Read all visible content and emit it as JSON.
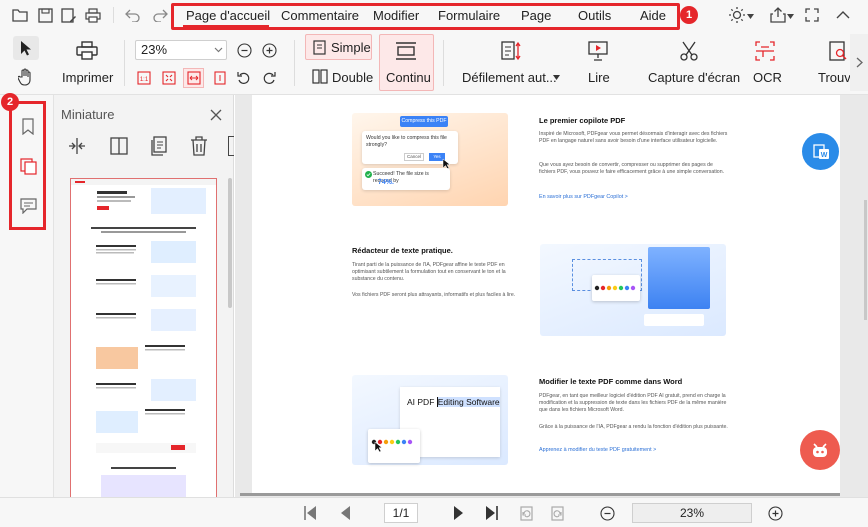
{
  "menu": {
    "tabs": [
      "Page d'accueil",
      "Commentaire",
      "Modifier",
      "Formulaire",
      "Page",
      "Outils",
      "Aide"
    ],
    "active_tab": "Page d'accueil",
    "annotation_1": "1",
    "annotation_2": "2"
  },
  "ribbon": {
    "print_label": "Imprimer",
    "zoom_value": "23%",
    "simple_label": "Simple",
    "double_label": "Double",
    "continu_label": "Continu",
    "scroll_label": "Défilement aut...",
    "read_label": "Lire",
    "capture_label": "Capture d'écran",
    "ocr_label": "OCR",
    "find_label": "Trouver"
  },
  "thumbnail_pane": {
    "title": "Miniature"
  },
  "document": {
    "section1": {
      "title": "Le premier copilote PDF",
      "text1": "Inspiré de Microsoft, PDFgear vous permet désormais d'interagir avec des fichiers PDF en langage naturel sans avoir besoin d'une interface utilisateur logicielle.",
      "text2": "Que vous ayez besoin de convertir, compresser ou supprimer des pages de fichiers PDF, vous pouvez le faire efficacement grâce à une simple conversation.",
      "link": "En savoir plus sur PDFgear Copilot >",
      "card_button": "Compress this PDF",
      "card_question": "Would you like to compress this file strongly?",
      "card_cancel": "Cancel",
      "card_yes": "Yes",
      "card_result": "Succeed! The file size is reduced by",
      "card_percent": "74%."
    },
    "section2": {
      "title": "Rédacteur de texte pratique.",
      "text1": "Tirant parti de la puissance de l'IA, PDFgear affine le texte PDF en optimisant subtilement la formulation tout en conservant le ton et la substance du contenu.",
      "text2": "Vos fichiers PDF seront plus attrayants, informatifs et plus faciles à lire."
    },
    "section3": {
      "title": "Modifier le texte PDF comme dans Word",
      "text1": "PDFgear, en tant que meilleur logiciel d'édition PDF AI gratuit, prend en charge la modification et la suppression de texte dans les fichiers PDF de la même manière que dans les fichiers Microsoft Word.",
      "text2": "Grâce à la puissance de l'IA, PDFgear a rendu la fonction d'édition plus puissante.",
      "link": "Apprenez à modifier du texte PDF gratuitement >",
      "editor_text_plain": "AI PDF ",
      "editor_text_selected": "Editing Software"
    }
  },
  "status": {
    "page_indicator": "1/1",
    "zoom_value": "23%"
  },
  "colors": {
    "accent_red": "#e5262b",
    "link_blue": "#2a6fd6",
    "active_tab_bg": "#fde8e8"
  }
}
